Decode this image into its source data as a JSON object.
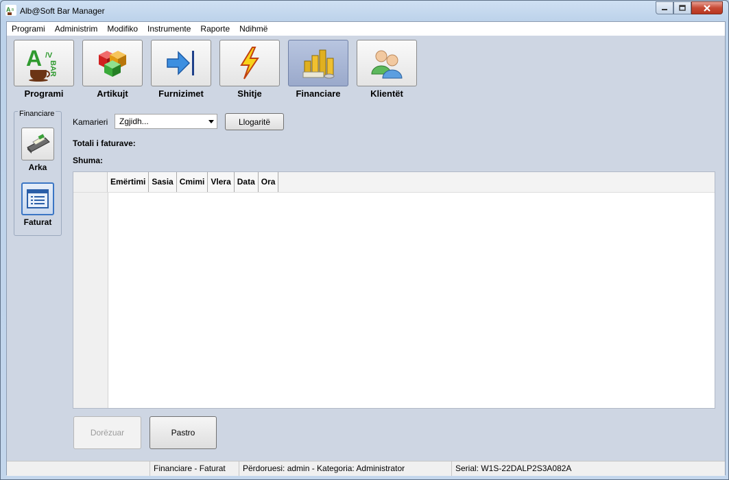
{
  "window": {
    "title": "Alb@Soft Bar Manager"
  },
  "menu": [
    "Programi",
    "Administrim",
    "Modifiko",
    "Instrumente",
    "Raporte",
    "Ndihmë"
  ],
  "modules": [
    {
      "label": "Programi",
      "icon": "albasoft-logo-icon"
    },
    {
      "label": "Artikujt",
      "icon": "boxes-icon"
    },
    {
      "label": "Furnizimet",
      "icon": "import-arrow-icon"
    },
    {
      "label": "Shitje",
      "icon": "lightning-icon"
    },
    {
      "label": "Financiare",
      "icon": "coins-icon",
      "active": true
    },
    {
      "label": "Klientët",
      "icon": "users-icon"
    }
  ],
  "submenu": {
    "title": "Financiare",
    "items": [
      {
        "label": "Arka",
        "icon": "cash-register-icon"
      },
      {
        "label": "Faturat",
        "icon": "invoice-list-icon",
        "active": true
      }
    ]
  },
  "filters": {
    "waiter_label": "Kamarieri",
    "waiter_value": "Zgjidh...",
    "accounts_button": "Llogaritë"
  },
  "summary": {
    "total_invoices_label": "Totali i faturave:",
    "sum_label": "Shuma:"
  },
  "table": {
    "columns": [
      "Emërtimi",
      "Sasia",
      "Cmimi",
      "Vlera",
      "Data",
      "Ora"
    ],
    "rows": []
  },
  "actions": {
    "delivered": "Dorëzuar",
    "clear": "Pastro"
  },
  "status": {
    "location": "Financiare - Faturat",
    "user": "Përdoruesi: admin - Kategoria: Administrator",
    "serial": "Serial: W1S-22DALP2S3A082A"
  },
  "colors": {
    "accent": "#3a75c4",
    "close_button": "#c74a35",
    "active_tile": "#9aa9cb"
  }
}
